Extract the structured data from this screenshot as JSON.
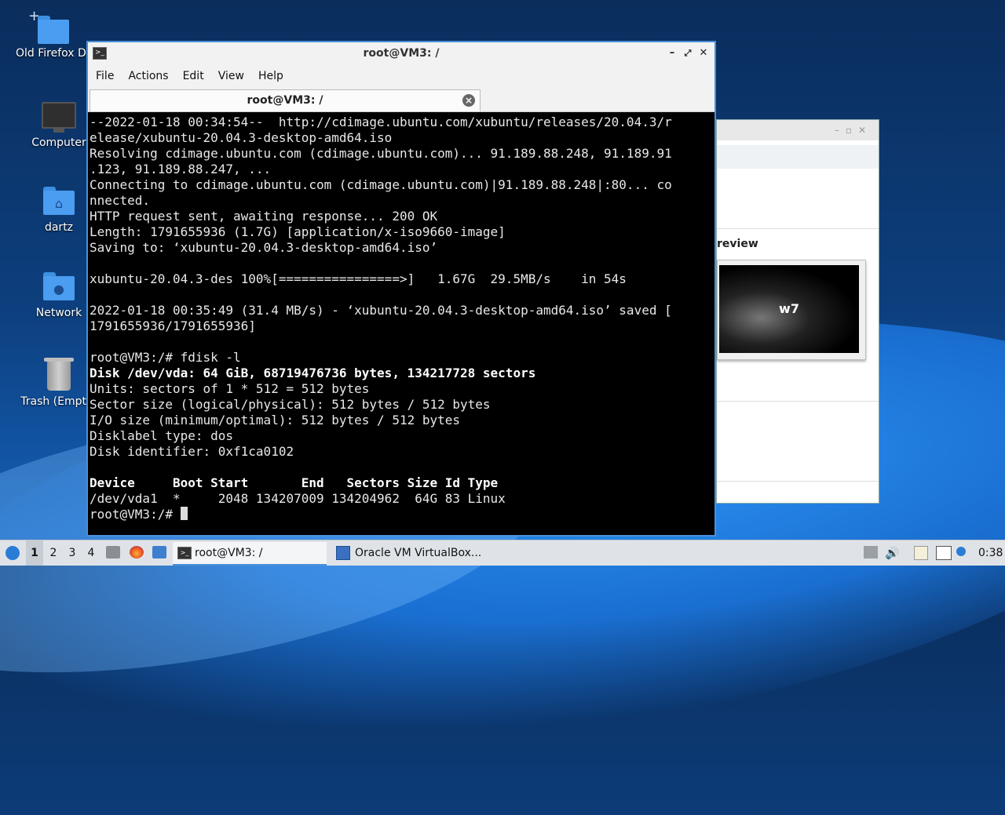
{
  "desktop": {
    "icons": [
      {
        "label": "Old Firefox Data",
        "icon": "folder-icon"
      },
      {
        "label": "Computer",
        "icon": "computer-icon"
      },
      {
        "label": "dartz",
        "icon": "home-folder-icon"
      },
      {
        "label": "Network",
        "icon": "network-folder-icon"
      },
      {
        "label": "Trash (Empty)",
        "icon": "trash-icon"
      }
    ]
  },
  "background_window": {
    "preview_label": "review",
    "preview_screen_text": "w7"
  },
  "terminal_window": {
    "title": "root@VM3: /",
    "menu": [
      "File",
      "Actions",
      "Edit",
      "View",
      "Help"
    ],
    "tab_label": "root@VM3: /",
    "lines": [
      {
        "text": "--2022-01-18 00:34:54--  http://cdimage.ubuntu.com/xubuntu/releases/20.04.3/r",
        "bold": false
      },
      {
        "text": "elease/xubuntu-20.04.3-desktop-amd64.iso",
        "bold": false
      },
      {
        "text": "Resolving cdimage.ubuntu.com (cdimage.ubuntu.com)... 91.189.88.248, 91.189.91",
        "bold": false
      },
      {
        "text": ".123, 91.189.88.247, ...",
        "bold": false
      },
      {
        "text": "Connecting to cdimage.ubuntu.com (cdimage.ubuntu.com)|91.189.88.248|:80... co",
        "bold": false
      },
      {
        "text": "nnected.",
        "bold": false
      },
      {
        "text": "HTTP request sent, awaiting response... 200 OK",
        "bold": false
      },
      {
        "text": "Length: 1791655936 (1.7G) [application/x-iso9660-image]",
        "bold": false
      },
      {
        "text": "Saving to: ‘xubuntu-20.04.3-desktop-amd64.iso’",
        "bold": false
      },
      {
        "text": "",
        "bold": false
      },
      {
        "text": "xubuntu-20.04.3-des 100%[================>]   1.67G  29.5MB/s    in 54s",
        "bold": false
      },
      {
        "text": "",
        "bold": false
      },
      {
        "text": "2022-01-18 00:35:49 (31.4 MB/s) - ‘xubuntu-20.04.3-desktop-amd64.iso’ saved [",
        "bold": false
      },
      {
        "text": "1791655936/1791655936]",
        "bold": false
      },
      {
        "text": "",
        "bold": false
      },
      {
        "text": "root@VM3:/# fdisk -l",
        "bold": false
      },
      {
        "text": "Disk /dev/vda: 64 GiB, 68719476736 bytes, 134217728 sectors",
        "bold": true
      },
      {
        "text": "Units: sectors of 1 * 512 = 512 bytes",
        "bold": false
      },
      {
        "text": "Sector size (logical/physical): 512 bytes / 512 bytes",
        "bold": false
      },
      {
        "text": "I/O size (minimum/optimal): 512 bytes / 512 bytes",
        "bold": false
      },
      {
        "text": "Disklabel type: dos",
        "bold": false
      },
      {
        "text": "Disk identifier: 0xf1ca0102",
        "bold": false
      },
      {
        "text": "",
        "bold": false
      },
      {
        "text": "Device     Boot Start       End   Sectors Size Id Type",
        "bold": true
      },
      {
        "text": "/dev/vda1  *     2048 134207009 134204962  64G 83 Linux",
        "bold": false
      }
    ],
    "prompt": "root@VM3:/# "
  },
  "taskbar": {
    "workspaces": [
      "1",
      "2",
      "3",
      "4"
    ],
    "active_workspace": "1",
    "tasks": [
      {
        "label": "root@VM3: /",
        "icon": "terminal-icon",
        "active": true
      },
      {
        "label": "Oracle VM VirtualBox...",
        "icon": "virtualbox-icon",
        "active": false
      }
    ],
    "clock": "0:38"
  }
}
